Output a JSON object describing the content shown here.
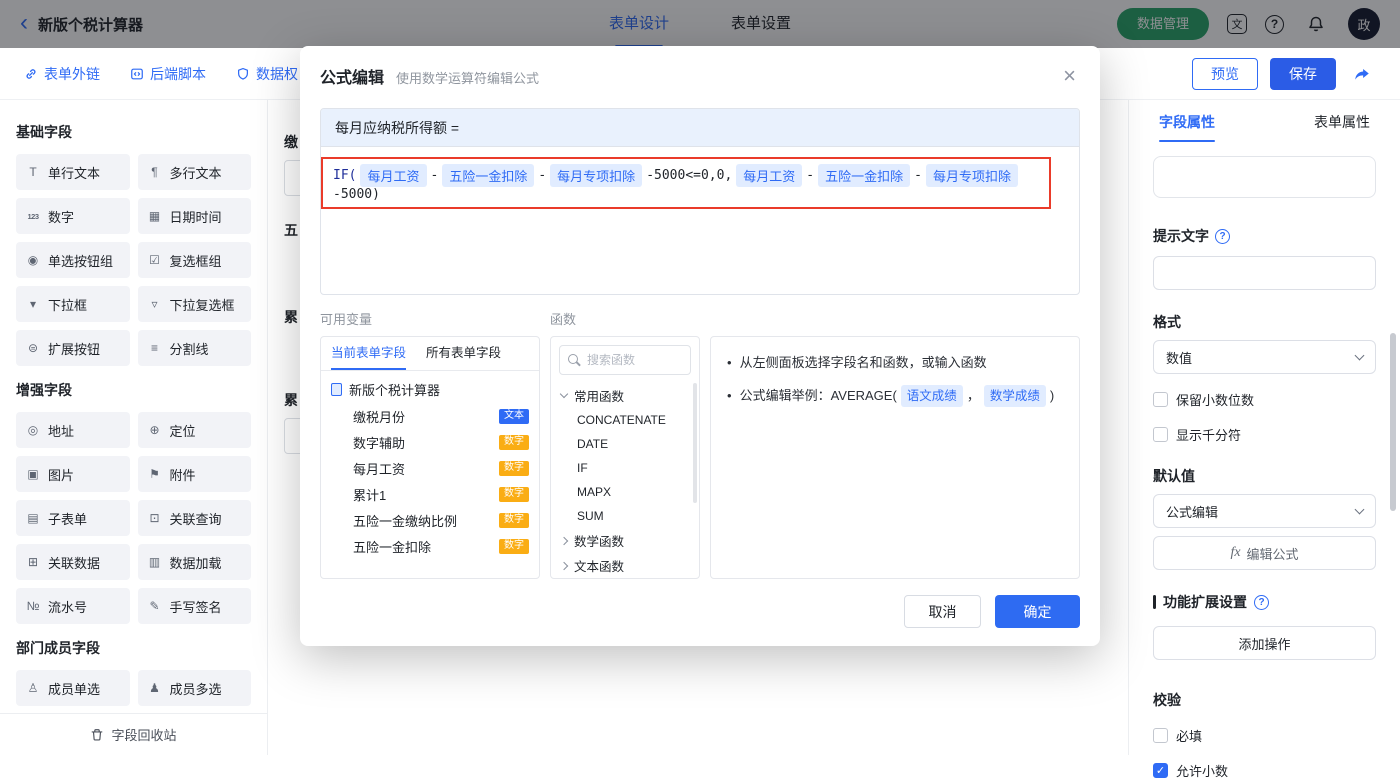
{
  "header": {
    "title": "新版个税计算器",
    "tabs": [
      {
        "label": "表单设计"
      },
      {
        "label": "表单设置"
      }
    ],
    "data_manage": "数据管理",
    "avatar": "政"
  },
  "toolbar": {
    "links": [
      {
        "label": "表单外链"
      },
      {
        "label": "后端脚本"
      },
      {
        "label": "数据权"
      }
    ],
    "preview": "预览",
    "save": "保存"
  },
  "sidebar": {
    "sections": [
      {
        "title": "基础字段",
        "items": [
          {
            "label": "单行文本",
            "icon": "T"
          },
          {
            "label": "多行文本",
            "icon": "¶"
          },
          {
            "label": "数字",
            "icon": "123"
          },
          {
            "label": "日期时间",
            "icon": "▦"
          },
          {
            "label": "单选按钮组",
            "icon": "◉"
          },
          {
            "label": "复选框组",
            "icon": "☑"
          },
          {
            "label": "下拉框",
            "icon": "▾"
          },
          {
            "label": "下拉复选框",
            "icon": "▿"
          },
          {
            "label": "扩展按钮",
            "icon": "⊜"
          },
          {
            "label": "分割线",
            "icon": "≡"
          }
        ]
      },
      {
        "title": "增强字段",
        "items": [
          {
            "label": "地址",
            "icon": "◎"
          },
          {
            "label": "定位",
            "icon": "⊕"
          },
          {
            "label": "图片",
            "icon": "▣"
          },
          {
            "label": "附件",
            "icon": "⚑"
          },
          {
            "label": "子表单",
            "icon": "▤"
          },
          {
            "label": "关联查询",
            "icon": "⊡"
          },
          {
            "label": "关联数据",
            "icon": "⊞"
          },
          {
            "label": "数据加载",
            "icon": "▥"
          },
          {
            "label": "流水号",
            "icon": "№"
          },
          {
            "label": "手写签名",
            "icon": "✎"
          }
        ]
      },
      {
        "title": "部门成员字段",
        "items": [
          {
            "label": "成员单选",
            "icon": "♙"
          },
          {
            "label": "成员多选",
            "icon": "♟"
          }
        ]
      }
    ],
    "recycle_bin": "字段回收站"
  },
  "canvas": {
    "labels": [
      {
        "text": "缴"
      },
      {
        "text": "五"
      },
      {
        "text": "累"
      },
      {
        "text": "累"
      }
    ]
  },
  "modal": {
    "title": "公式编辑",
    "subtitle": "使用数学运算符编辑公式",
    "close": "×",
    "formula_target": "每月应纳税所得额 =",
    "tokens": [
      {
        "t": "fn",
        "v": "IF("
      },
      {
        "t": "chip",
        "v": "每月工资"
      },
      {
        "t": "op",
        "v": "-"
      },
      {
        "t": "chip",
        "v": "五险一金扣除"
      },
      {
        "t": "op",
        "v": "-"
      },
      {
        "t": "chip",
        "v": "每月专项扣除"
      },
      {
        "t": "op",
        "v": "-5000<=0,0,"
      },
      {
        "t": "chip",
        "v": "每月工资"
      },
      {
        "t": "op",
        "v": "-"
      },
      {
        "t": "chip",
        "v": "五险一金扣除"
      },
      {
        "t": "op",
        "v": "-"
      },
      {
        "t": "chip",
        "v": "每月专项扣除"
      },
      {
        "t": "op",
        "v": "-5000)"
      }
    ],
    "variables": {
      "label": "可用变量",
      "tabs": [
        {
          "label": "当前表单字段"
        },
        {
          "label": "所有表单字段"
        }
      ],
      "root": "新版个税计算器",
      "fields": [
        {
          "name": "缴税月份",
          "type": "文本"
        },
        {
          "name": "数字辅助",
          "type": "数字"
        },
        {
          "name": "每月工资",
          "type": "数字"
        },
        {
          "name": "累计1",
          "type": "数字"
        },
        {
          "name": "五险一金缴纳比例",
          "type": "数字"
        },
        {
          "name": "五险一金扣除",
          "type": "数字"
        }
      ]
    },
    "functions": {
      "label": "函数",
      "search_placeholder": "搜索函数",
      "groups": [
        {
          "name": "常用函数"
        },
        {
          "name": "数学函数"
        },
        {
          "name": "文本函数"
        }
      ],
      "common_items": [
        "CONCATENATE",
        "DATE",
        "IF",
        "MAPX",
        "SUM"
      ]
    },
    "help": {
      "tip1": "从左侧面板选择字段名和函数，或输入函数",
      "tip2_prefix": "公式编辑举例：AVERAGE(",
      "tip2_chip1": "语文成绩",
      "tip2_sep": "，",
      "tip2_chip2": "数学成绩",
      "tip2_suffix": ")"
    },
    "cancel": "取消",
    "confirm": "确定"
  },
  "right_panel": {
    "tabs": [
      {
        "label": "字段属性"
      },
      {
        "label": "表单属性"
      }
    ],
    "hint_label": "提示文字",
    "format_label": "格式",
    "format_value": "数值",
    "opt_decimal": "保留小数位数",
    "opt_thousand": "显示千分符",
    "default_label": "默认值",
    "default_value": "公式编辑",
    "fx": "fx",
    "edit_formula": "编辑公式",
    "extension_title": "功能扩展设置",
    "add_action": "添加操作",
    "validation_title": "校验",
    "opt_required": "必填",
    "opt_allow_decimal": "允许小数"
  }
}
